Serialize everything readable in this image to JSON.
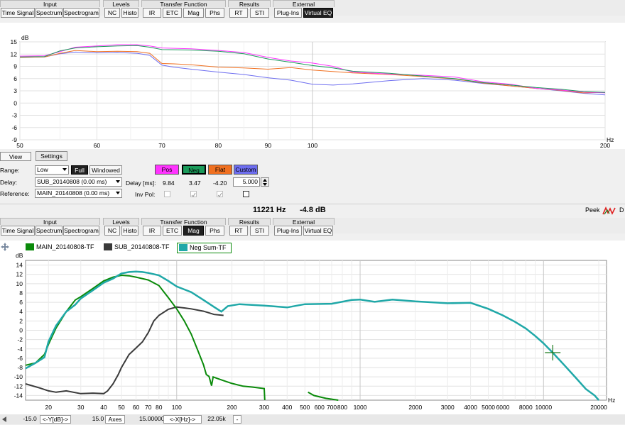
{
  "toolbar_top": {
    "groups": [
      {
        "title": "Input",
        "buttons": [
          "Time Signal",
          "Spectrum",
          "Spectrogram"
        ]
      },
      {
        "title": "Levels",
        "buttons": [
          "NC",
          "Histo"
        ]
      },
      {
        "title": "Transfer Function",
        "buttons": [
          "IR",
          "ETC",
          "Mag",
          "Phs"
        ]
      },
      {
        "title": "Results",
        "buttons": [
          "RT",
          "STI"
        ]
      },
      {
        "title": "External",
        "buttons": [
          "Plug-Ins",
          "Virtual EQ"
        ]
      }
    ],
    "active": "Virtual EQ"
  },
  "toolbar_bottom": {
    "groups": [
      {
        "title": "Input",
        "buttons": [
          "Time Signal",
          "Spectrum",
          "Spectrogram"
        ]
      },
      {
        "title": "Levels",
        "buttons": [
          "NC",
          "Histo"
        ]
      },
      {
        "title": "Transfer Function",
        "buttons": [
          "IR",
          "ETC",
          "Mag",
          "Phs"
        ]
      },
      {
        "title": "Results",
        "buttons": [
          "RT",
          "STI"
        ]
      },
      {
        "title": "External",
        "buttons": [
          "Plug-Ins",
          "Virtual EQ"
        ]
      }
    ],
    "active": "Mag"
  },
  "top_chart": {
    "y_unit": "dB",
    "x_unit": "Hz",
    "y_ticks": [
      "15",
      "12",
      "9",
      "6",
      "3",
      "0",
      "-3",
      "-6",
      "-9"
    ],
    "x_ticks": [
      "50",
      "60",
      "70",
      "80",
      "90",
      "100",
      "200"
    ]
  },
  "controls": {
    "view_tab": "View",
    "settings_tab": "Settings",
    "range_label": "Range:",
    "range_value": "Low",
    "full_btn": "Full",
    "windowed_btn": "Windowed",
    "delay_label": "Delay:",
    "delay_value": "SUB_20140808 (0.00 ms)",
    "reference_label": "Reference:",
    "reference_value": "MAIN_20140808 (0.00 ms)",
    "delay_ms_label": "Delay [ms]:",
    "inv_pol_label": "Inv Pol:",
    "chips": [
      {
        "label": "Pos",
        "color": "#ff33ff",
        "delay": "9.84",
        "checked": false
      },
      {
        "label": "Neg",
        "color": "#1a9a5a",
        "delay": "3.47",
        "checked": true
      },
      {
        "label": "Flat",
        "color": "#f07020",
        "delay": "-4.20",
        "checked": true
      },
      {
        "label": "Custom",
        "color": "#6e6ef0",
        "delay": "5.000",
        "checked": false
      }
    ]
  },
  "readout": {
    "freq": "11221 Hz",
    "level": "-4.8 dB"
  },
  "brand": {
    "name": "Peek",
    "trail": "D"
  },
  "bottom_chart": {
    "legend": [
      {
        "name": "MAIN_20140808-TF",
        "color": "#0a8a0a"
      },
      {
        "name": "SUB_20140808-TF",
        "color": "#3a3a3a"
      },
      {
        "name": "Neg Sum-TF",
        "color": "#20a8a8"
      }
    ],
    "y_unit": "dB",
    "x_unit": "Hz",
    "y_ticks": [
      "14",
      "12",
      "10",
      "8",
      "6",
      "4",
      "2",
      "0",
      "-2",
      "-4",
      "-6",
      "-8",
      "-10",
      "-12",
      "-14"
    ],
    "x_ticks": [
      "20",
      "30",
      "40",
      "50",
      "60",
      "70",
      "80",
      "100",
      "200",
      "300",
      "400",
      "500",
      "600",
      "700",
      "800",
      "1000",
      "2000",
      "3000",
      "4000",
      "5000",
      "6000",
      "8000",
      "10000",
      "20000"
    ],
    "cursor": {
      "freq_hz": 11221,
      "level_db": -4.8
    }
  },
  "bottombar": {
    "ymin": "-15.0",
    "ybtn": "<-Y[dB]->",
    "ymax": "15.0",
    "axes": "Axes",
    "xmin": "15.00000",
    "xbtn": "<-X[Hz]->",
    "xmax": "22.05k",
    "minus": "-"
  }
}
